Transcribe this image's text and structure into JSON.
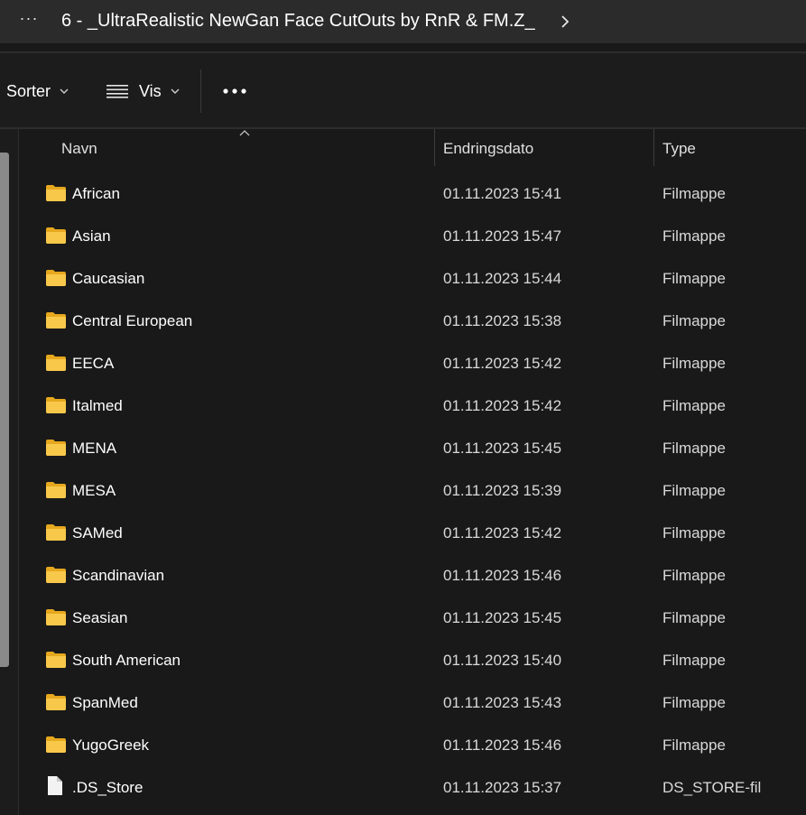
{
  "address": {
    "overflow_label": "···",
    "path": "6 - _UltraRealistic NewGan Face CutOuts by RnR & FM.Z_"
  },
  "toolbar": {
    "sort_label": "Sorter",
    "view_label": "Vis"
  },
  "columns": {
    "name": "Navn",
    "date": "Endringsdato",
    "type": "Type"
  },
  "files": [
    {
      "name": "African",
      "date": "01.11.2023 15:41",
      "type": "Filmappe",
      "kind": "folder"
    },
    {
      "name": "Asian",
      "date": "01.11.2023 15:47",
      "type": "Filmappe",
      "kind": "folder"
    },
    {
      "name": "Caucasian",
      "date": "01.11.2023 15:44",
      "type": "Filmappe",
      "kind": "folder"
    },
    {
      "name": "Central European",
      "date": "01.11.2023 15:38",
      "type": "Filmappe",
      "kind": "folder"
    },
    {
      "name": "EECA",
      "date": "01.11.2023 15:42",
      "type": "Filmappe",
      "kind": "folder"
    },
    {
      "name": "Italmed",
      "date": "01.11.2023 15:42",
      "type": "Filmappe",
      "kind": "folder"
    },
    {
      "name": "MENA",
      "date": "01.11.2023 15:45",
      "type": "Filmappe",
      "kind": "folder"
    },
    {
      "name": "MESA",
      "date": "01.11.2023 15:39",
      "type": "Filmappe",
      "kind": "folder"
    },
    {
      "name": "SAMed",
      "date": "01.11.2023 15:42",
      "type": "Filmappe",
      "kind": "folder"
    },
    {
      "name": "Scandinavian",
      "date": "01.11.2023 15:46",
      "type": "Filmappe",
      "kind": "folder"
    },
    {
      "name": "Seasian",
      "date": "01.11.2023 15:45",
      "type": "Filmappe",
      "kind": "folder"
    },
    {
      "name": "South American",
      "date": "01.11.2023 15:40",
      "type": "Filmappe",
      "kind": "folder"
    },
    {
      "name": "SpanMed",
      "date": "01.11.2023 15:43",
      "type": "Filmappe",
      "kind": "folder"
    },
    {
      "name": "YugoGreek",
      "date": "01.11.2023 15:46",
      "type": "Filmappe",
      "kind": "folder"
    },
    {
      "name": ".DS_Store",
      "date": "01.11.2023 15:37",
      "type": "DS_STORE-fil",
      "kind": "file"
    }
  ],
  "colors": {
    "folder": "#f5c242",
    "background": "#191919"
  }
}
